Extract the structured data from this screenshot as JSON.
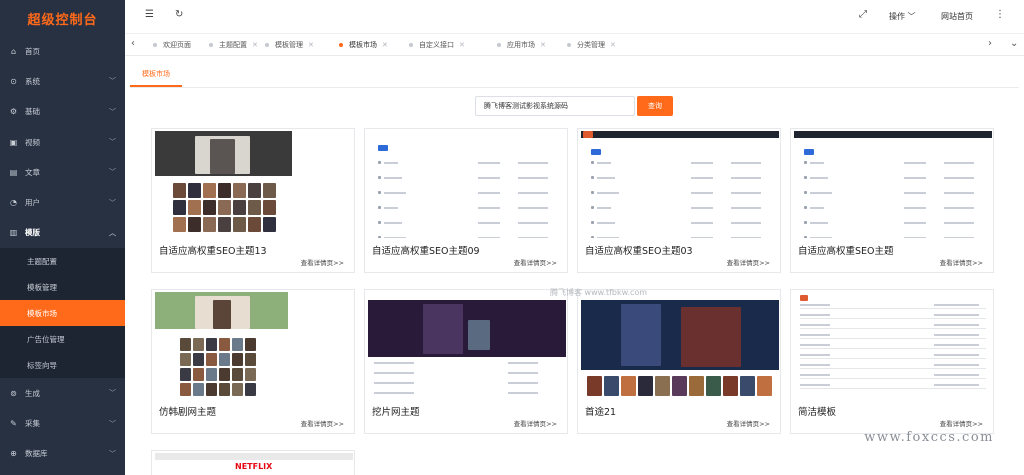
{
  "brand": "超级控制台",
  "sidebar": {
    "items_top": [
      {
        "label": "首页",
        "icon": "home-icon",
        "glyph": "⌂"
      },
      {
        "label": "系统",
        "icon": "system-icon",
        "glyph": "⊙"
      },
      {
        "label": "基础",
        "icon": "basic-icon",
        "glyph": "⚙"
      },
      {
        "label": "视频",
        "icon": "video-icon",
        "glyph": "▣"
      },
      {
        "label": "文章",
        "icon": "article-icon",
        "glyph": "▤"
      },
      {
        "label": "用户",
        "icon": "user-icon",
        "glyph": "◔"
      }
    ],
    "open_item": {
      "label": "模版",
      "icon": "template-icon",
      "glyph": "▥"
    },
    "sub_items": [
      "主题配置",
      "模板管理",
      "模板市场",
      "广告位管理",
      "标签向导"
    ],
    "active_sub": "模板市场",
    "items_bottom": [
      {
        "label": "生成",
        "icon": "generate-icon",
        "glyph": "⊚"
      },
      {
        "label": "采集",
        "icon": "collect-icon",
        "glyph": "✎"
      },
      {
        "label": "数据库",
        "icon": "database-icon",
        "glyph": "⊕"
      }
    ]
  },
  "topbar": {
    "operation": "操作",
    "site_home": "网站首页"
  },
  "tabs": [
    {
      "label": "欢迎页面",
      "closable": false
    },
    {
      "label": "主题配置",
      "closable": true
    },
    {
      "label": "模板管理",
      "closable": true
    },
    {
      "label": "模板市场",
      "closable": true,
      "active": true
    },
    {
      "label": "自定义接口",
      "closable": true
    },
    {
      "label": "应用市场",
      "closable": true
    },
    {
      "label": "分类管理",
      "closable": true
    }
  ],
  "content": {
    "subtab": "模板市场",
    "search_value": "腾飞博客测试影视系统源码",
    "search_button": "查询",
    "detail_link": "查看详情页>>",
    "center_watermark": "腾飞博客 www.tfbkw.com",
    "watermark": "www.foxccs.com",
    "cards": [
      {
        "title": "自适应高权重SEO主题13"
      },
      {
        "title": "自适应高权重SEO主题09"
      },
      {
        "title": "自适应高权重SEO主题03"
      },
      {
        "title": "自适应高权重SEO主题"
      },
      {
        "title": "仿韩剧网主题"
      },
      {
        "title": "挖片网主题"
      },
      {
        "title": "首途21"
      },
      {
        "title": "简洁模板"
      }
    ],
    "partial_card_text": "NETFLIX"
  }
}
